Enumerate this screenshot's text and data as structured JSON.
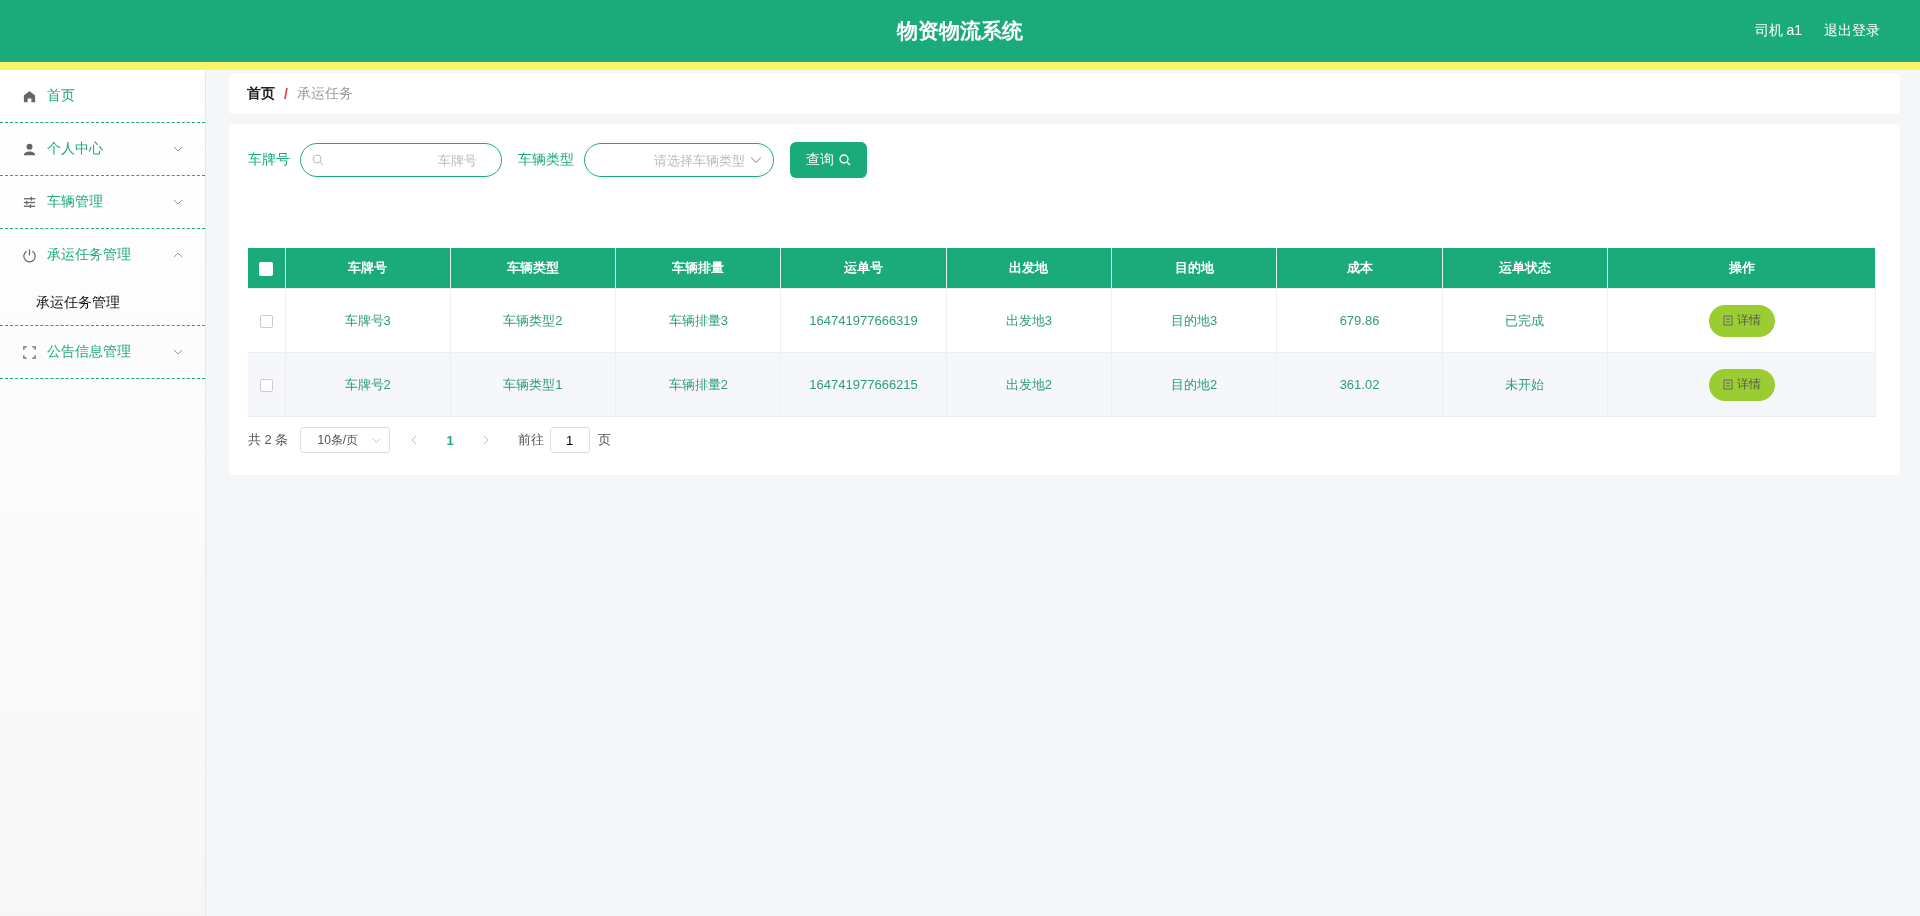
{
  "header": {
    "title": "物资物流系统",
    "user": "司机 a1",
    "logout": "退出登录"
  },
  "sidebar": {
    "items": [
      {
        "label": "首页"
      },
      {
        "label": "个人中心",
        "expanded": false
      },
      {
        "label": "车辆管理",
        "expanded": false
      },
      {
        "label": "承运任务管理",
        "expanded": true,
        "children": [
          {
            "label": "承运任务管理",
            "selected": true
          }
        ]
      },
      {
        "label": "公告信息管理",
        "expanded": false
      }
    ]
  },
  "breadcrumb": {
    "separator": "/",
    "items": [
      "首页",
      "承运任务"
    ]
  },
  "search": {
    "fields": [
      {
        "label": "车牌号",
        "placeholder": "车牌号",
        "kind": "text"
      },
      {
        "label": "车辆类型",
        "placeholder": "请选择车辆类型",
        "kind": "select"
      }
    ],
    "button": "查询"
  },
  "table": {
    "select_all": false,
    "columns": [
      "车牌号",
      "车辆类型",
      "车辆排量",
      "运单号",
      "出发地",
      "目的地",
      "成本",
      "运单状态",
      "操作"
    ],
    "rows": [
      {
        "selected": false,
        "cells": [
          "车牌号3",
          "车辆类型2",
          "车辆排量3",
          "164741977666319",
          "出发地3",
          "目的地3",
          "679.86",
          "已完成"
        ],
        "action": "详情"
      },
      {
        "selected": false,
        "cells": [
          "车牌号2",
          "车辆类型1",
          "车辆排量2",
          "164741977666215",
          "出发地2",
          "目的地2",
          "361.02",
          "未开始"
        ],
        "action": "详情"
      }
    ]
  },
  "pagination": {
    "total": "共 2 条",
    "page_size": "10条/页",
    "pages": [
      {
        "label": "1",
        "selected": true
      }
    ],
    "goto_label": "前往",
    "goto_value": "1",
    "goto_suffix": "页"
  }
}
